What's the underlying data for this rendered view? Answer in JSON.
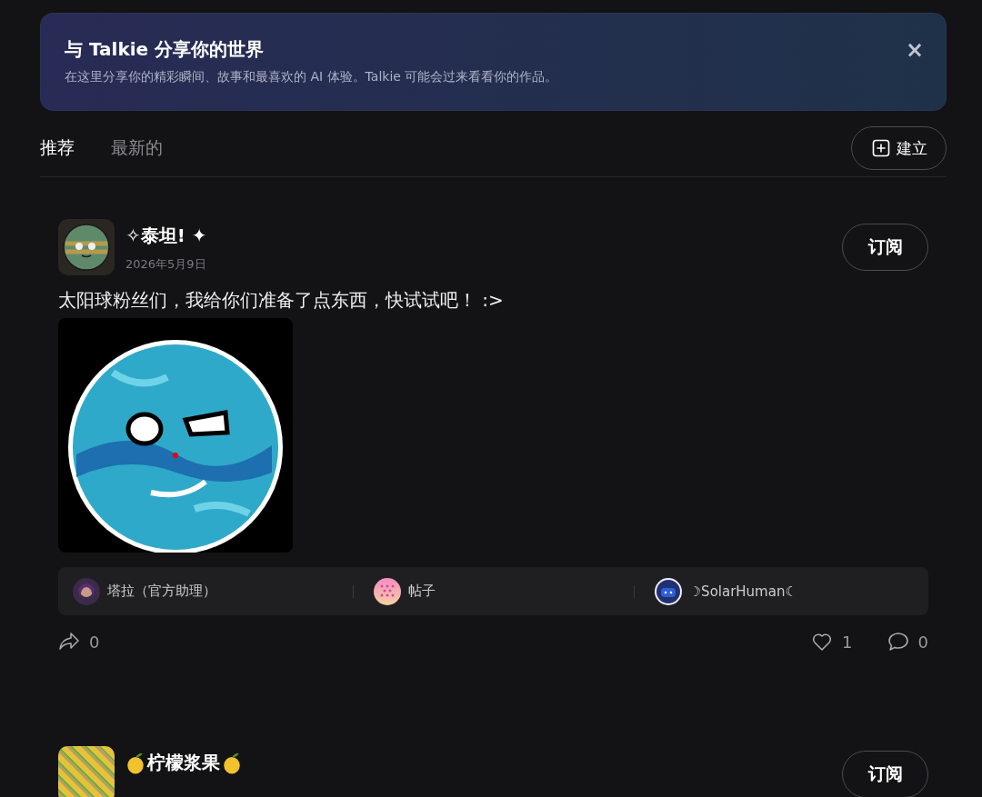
{
  "banner": {
    "title": "与 Talkie 分享你的世界",
    "text": "在这里分享你的精彩瞬间、故事和最喜欢的 AI 体验。Talkie 可能会过来看看你的作品。",
    "close": "×"
  },
  "tabs": [
    {
      "label": "推荐",
      "selected": true
    },
    {
      "label": "最新的",
      "selected": false
    }
  ],
  "create_button": "建立",
  "posts": [
    {
      "author": "✧泰坦! ✦",
      "date": "2026年5月9日",
      "subscribe": "订阅",
      "text": "太阳球粉丝们，我给你们准备了点东西，快试试吧！ :>",
      "kind": "image",
      "tags": [
        {
          "label": "塔拉（官方助理）",
          "kind": "portrait"
        },
        {
          "label": "帖子",
          "kind": "dots"
        },
        {
          "label": "☽SolarHuman☾",
          "kind": "robot"
        }
      ],
      "shares": "0",
      "likes": "1",
      "comments": "0"
    },
    {
      "author": "柠檬浆果",
      "subscribe": "订阅",
      "kind": "emoji"
    }
  ]
}
